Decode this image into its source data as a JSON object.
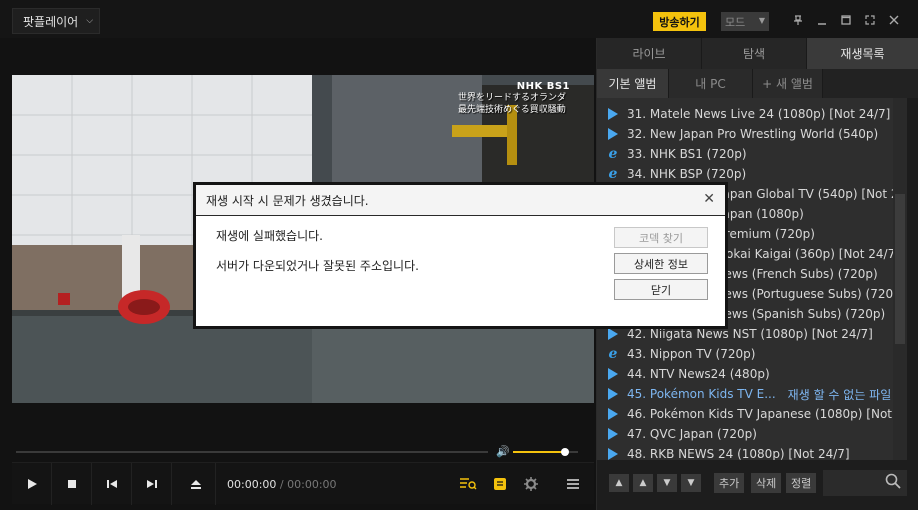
{
  "titlebar": {
    "app_name": "팟플레이어",
    "broadcast_label": "방송하기",
    "mode_label": "모드"
  },
  "video": {
    "channel_logo": "NHK BS1",
    "caption_line1": "世界をリードするオランダ",
    "caption_line2": "最先端技術めぐる買収騒動"
  },
  "controls": {
    "current_time": "00:00:00",
    "separator": "/",
    "total_time": "00:00:00",
    "volume_level": 0.8
  },
  "panel": {
    "tabs": [
      "라이브",
      "탐색",
      "재생목록"
    ],
    "active_tab": "재생목록",
    "subtabs": [
      "기본 앨범",
      "내 PC",
      "+ 새 앨범"
    ],
    "playlist": [
      {
        "label": "31. Matele News Live 24 (1080p) [Not 24/7]",
        "icon": "play-triangle-icon",
        "status": ""
      },
      {
        "label": "32. New Japan Pro Wrestling World (540p)",
        "icon": "play-triangle-icon",
        "status": ""
      },
      {
        "label": "33. NHK BS1 (720p)",
        "icon": "ie-icon",
        "status": ""
      },
      {
        "label": "34. NHK BSP (720p)",
        "icon": "ie-icon",
        "status": ""
      },
      {
        "label": "35. NHK World-Japan Global TV (540p) [Not 24/7]",
        "icon": "play-triangle-icon",
        "status": ""
      },
      {
        "label": "36. NHK World-Japan (1080p)",
        "icon": "play-triangle-icon",
        "status": ""
      },
      {
        "label": "37. NHK World Premium (720p)",
        "icon": "play-triangle-icon",
        "status": ""
      },
      {
        "label": "38. Nico Nico Chokai Kaigai (360p) [Not 24/7]",
        "icon": "play-triangle-icon",
        "status": ""
      },
      {
        "label": "39. Nippon TV News (French Subs) (720p)",
        "icon": "play-triangle-icon",
        "status": ""
      },
      {
        "label": "40. Nippon TV News (Portuguese Subs) (720p)",
        "icon": "play-triangle-icon",
        "status": ""
      },
      {
        "label": "41. Nippon TV News (Spanish Subs) (720p)",
        "icon": "play-triangle-icon",
        "status": ""
      },
      {
        "label": "42. Niigata News NST (1080p) [Not 24/7]",
        "icon": "play-triangle-icon",
        "status": ""
      },
      {
        "label": "43. Nippon TV (720p)",
        "icon": "ie-icon",
        "status": ""
      },
      {
        "label": "44. NTV News24 (480p)",
        "icon": "play-triangle-icon",
        "status": ""
      },
      {
        "label": "45. Pokémon Kids TV E...",
        "icon": "play-triangle-icon",
        "status": "재생 할 수 없는 파일"
      },
      {
        "label": "46. Pokémon Kids TV Japanese (1080p) [Not ...",
        "icon": "play-triangle-icon",
        "status": ""
      },
      {
        "label": "47. QVC Japan (720p)",
        "icon": "play-triangle-icon",
        "status": ""
      },
      {
        "label": "48. RKB NEWS 24 (1080p) [Not 24/7]",
        "icon": "play-triangle-icon",
        "status": ""
      }
    ],
    "footer": {
      "add_label": "추가",
      "delete_label": "삭제",
      "sort_label": "정렬"
    }
  },
  "dialog": {
    "title": "재생 시작 시 문제가 생겼습니다.",
    "message1": "재생에 실패했습니다.",
    "message2": "서버가 다운되었거나 잘못된 주소입니다.",
    "codec_button": "코덱 찾기",
    "details_button": "상세한 정보",
    "close_button": "닫기"
  },
  "colors": {
    "accent": "#f4c20d",
    "error_link": "#7eb6f0",
    "play_icon": "#4aa8f0"
  }
}
